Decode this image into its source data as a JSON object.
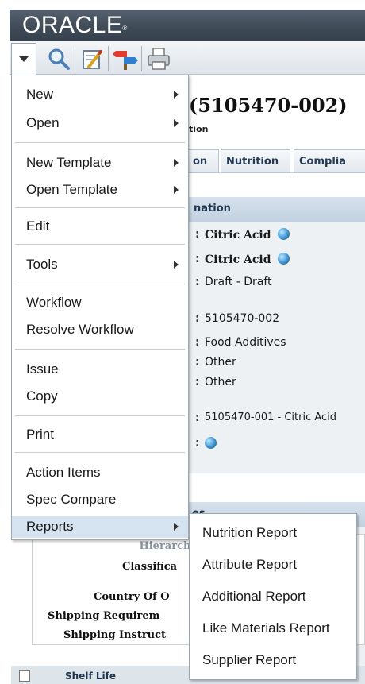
{
  "header": {
    "logo_text": "ORACLE",
    "logo_mark": "®"
  },
  "toolbar": {
    "icons": [
      "dropdown-arrow-icon",
      "search-icon",
      "edit-icon",
      "signpost-icon",
      "printer-icon"
    ]
  },
  "page": {
    "title": "(5105470-002)",
    "subtitle": "tion",
    "tabs": [
      "on",
      "Nutrition",
      "Complia"
    ],
    "section_header": "nation",
    "fields": {
      "name_1": "Citric Acid",
      "name_2": "Citric Acid",
      "status": "Draft - Draft",
      "number": "5105470-002",
      "category": "Food Additives",
      "type_1": "Other",
      "type_2": "Other",
      "template": "5105470-001 - Citric Acid"
    },
    "section2_header": "es",
    "labels": {
      "hierarchy": "Hierarchy",
      "classification": "Classifica",
      "country": "Country Of O",
      "shipping_req": "Shipping Requirem",
      "shipping_inst": "Shipping Instruct"
    },
    "shelf_label": "Shelf Life"
  },
  "menu": {
    "items": [
      {
        "label": "New",
        "submenu": true
      },
      {
        "label": "Open",
        "submenu": true
      },
      {
        "label": "New Template",
        "submenu": true
      },
      {
        "label": "Open Template",
        "submenu": true
      },
      {
        "label": "Edit",
        "submenu": false
      },
      {
        "label": "Tools",
        "submenu": true
      },
      {
        "label": "Workflow",
        "submenu": false
      },
      {
        "label": "Resolve Workflow",
        "submenu": false
      },
      {
        "label": "Issue",
        "submenu": false
      },
      {
        "label": "Copy",
        "submenu": false
      },
      {
        "label": "Print",
        "submenu": false
      },
      {
        "label": "Action Items",
        "submenu": false
      },
      {
        "label": "Spec Compare",
        "submenu": false
      },
      {
        "label": "Reports",
        "submenu": true,
        "active": true
      }
    ]
  },
  "reports_submenu": {
    "items": [
      "Nutrition Report",
      "Attribute Report",
      "Additional Report",
      "Like Materials Report",
      "Supplier Report"
    ]
  },
  "colors": {
    "header": "#3f4a57",
    "menu_highlight": "#d6e3f1",
    "panel_header": "#c2d1e0"
  }
}
